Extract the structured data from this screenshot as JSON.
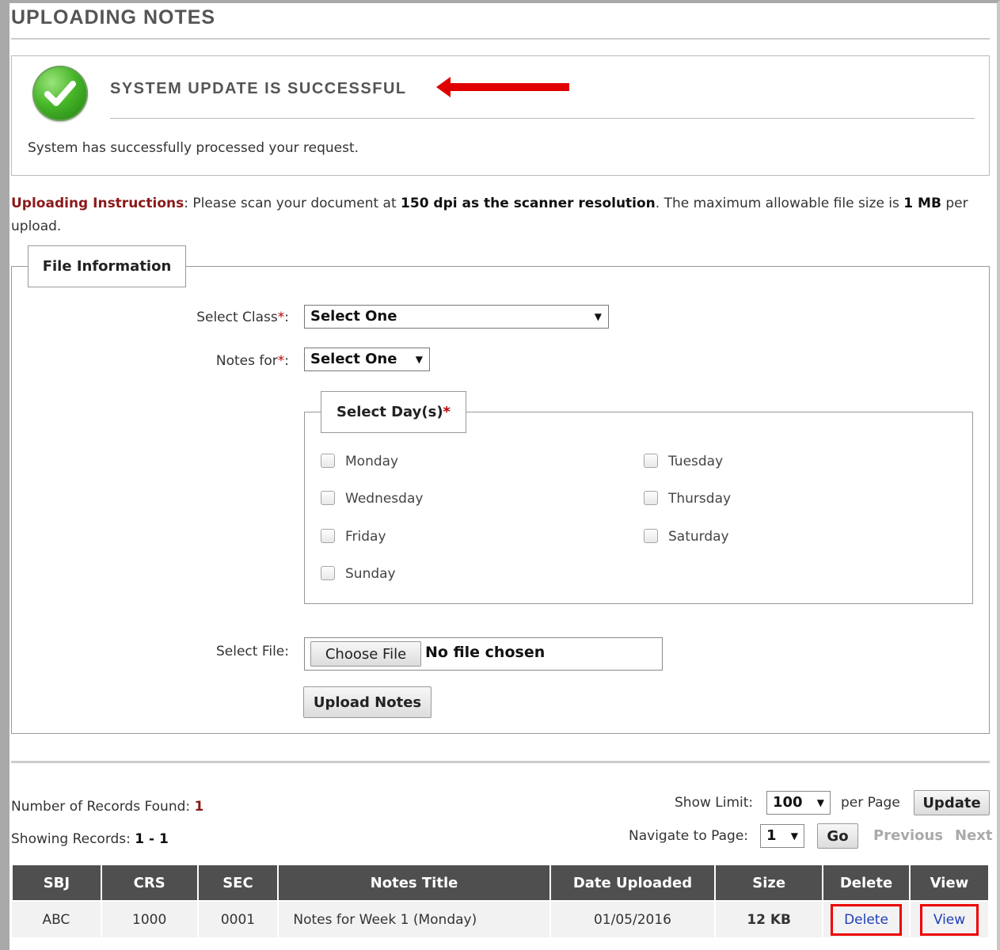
{
  "page": {
    "title": "UPLOADING NOTES"
  },
  "success": {
    "title": "SYSTEM UPDATE IS SUCCESSFUL",
    "message": "System has successfully processed your request."
  },
  "instructions": {
    "label": "Uploading Instructions",
    "text1": ": Please scan your document at ",
    "bold1": "150 dpi as the scanner resolution",
    "text2": ". The maximum allowable file size is ",
    "bold2": "1 MB",
    "text3": " per upload."
  },
  "file_info": {
    "legend": "File Information",
    "select_class_label": "Select Class",
    "select_class_value": "Select One",
    "notes_for_label": "Notes for",
    "notes_for_value": "Select One",
    "required_mark": "*",
    "colon": ":",
    "days_legend": "Select Day(s)",
    "days": [
      {
        "label": "Monday",
        "checked": false
      },
      {
        "label": "Tuesday",
        "checked": false
      },
      {
        "label": "Wednesday",
        "checked": false
      },
      {
        "label": "Thursday",
        "checked": false
      },
      {
        "label": "Friday",
        "checked": false
      },
      {
        "label": "Saturday",
        "checked": false
      },
      {
        "label": "Sunday",
        "checked": false
      }
    ],
    "select_file_label": "Select File:",
    "choose_file_label": "Choose File",
    "file_status": "No file chosen",
    "upload_button": "Upload Notes"
  },
  "records": {
    "found_label": "Number of Records Found: ",
    "found_count": "1",
    "showing_label": "Showing Records: ",
    "showing_range": "1 - 1",
    "show_limit_label": "Show Limit:",
    "show_limit_value": "100",
    "per_page_label": "per Page",
    "update_button": "Update",
    "navigate_label": "Navigate to Page:",
    "page_value": "1",
    "go_button": "Go",
    "previous_label": "Previous",
    "next_label": "Next"
  },
  "table": {
    "headers": [
      "SBJ",
      "CRS",
      "SEC",
      "Notes Title",
      "Date Uploaded",
      "Size",
      "Delete",
      "View"
    ],
    "rows": [
      {
        "sbj": "ABC",
        "crs": "1000",
        "sec": "0001",
        "title": "Notes for Week 1 (Monday)",
        "date": "01/05/2016",
        "size": "12 KB",
        "delete": "Delete",
        "view": "View"
      }
    ]
  },
  "colors": {
    "accent_red": "#e00000",
    "label_red": "#8b1a1a",
    "header_bg": "#4f4f4f",
    "link": "#1f3fb8"
  }
}
